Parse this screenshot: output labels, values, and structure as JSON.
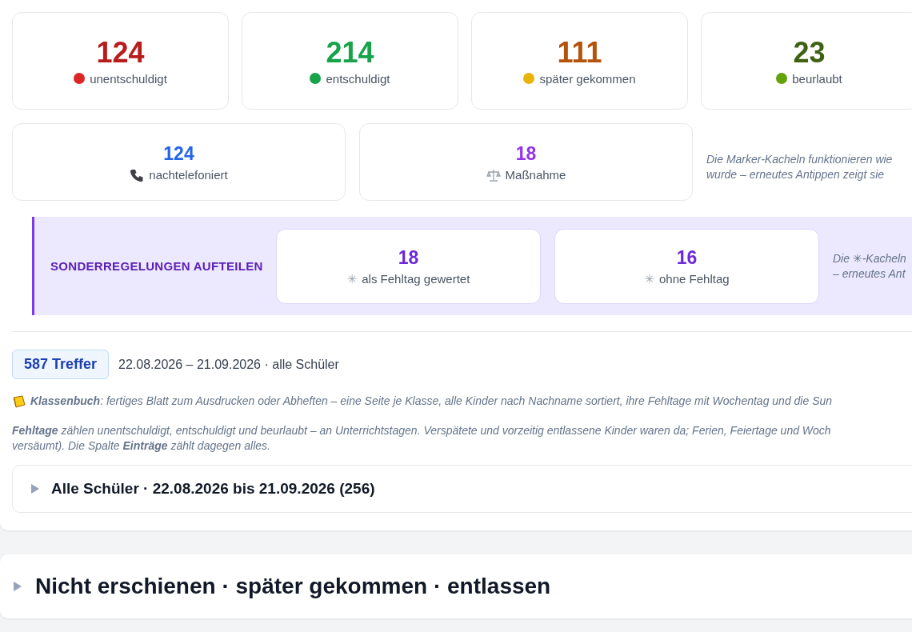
{
  "status_tiles": [
    {
      "count": "124",
      "label": "unentschuldigt",
      "color": "#dc2626"
    },
    {
      "count": "214",
      "label": "entschuldigt",
      "color": "#16a34a"
    },
    {
      "count": "111",
      "label": "später gekommen",
      "color": "#eab308"
    },
    {
      "count": "23",
      "label": "beurlaubt",
      "color": "#65a30d"
    }
  ],
  "marker_tiles": [
    {
      "count": "124",
      "label": "nachtelefoniert"
    },
    {
      "count": "18",
      "label": "Maßnahme"
    }
  ],
  "marker_note": [
    "Die Marker-Kacheln funktionieren wie",
    "wurde – erneutes Antippen zeigt sie"
  ],
  "special": {
    "title": "SONDERREGELUNGEN AUFTEILEN",
    "tiles": [
      {
        "count": "18",
        "symbol": "✳",
        "label": "als Fehltag gewertet"
      },
      {
        "count": "16",
        "symbol": "✳",
        "label": "ohne Fehltag"
      }
    ],
    "note": [
      "Die ✳-Kacheln",
      "– erneutes Ant"
    ]
  },
  "result": {
    "badge": "587 Treffer",
    "summary": "22.08.2026 – 21.09.2026 · alle Schüler"
  },
  "notes": [
    {
      "lines": [
        "**Klassenbuch**: fertiges Blatt zum Ausdrucken oder Abheften – eine Seite je Klasse, alle Kinder nach Nachname sortiert, ihre Fehltage mit Wochentag und die Sun"
      ]
    },
    {
      "lines": [
        "**Fehltage** zählen unentschuldigt, entschuldigt und beurlaubt – an Unterrichtstagen. Verspätete und vorzeitig entlassene Kinder waren da; Ferien, Feiertage und Woch",
        "versäumt). Die Spalte **Einträge** zählt dagegen alles."
      ]
    }
  ],
  "group": {
    "title": "Alle Schüler · 22.08.2026 bis 21.09.2026 (256)",
    "expanded": false
  },
  "section": {
    "title": "Nicht erschienen · später gekommen · entlassen",
    "expanded": false
  }
}
